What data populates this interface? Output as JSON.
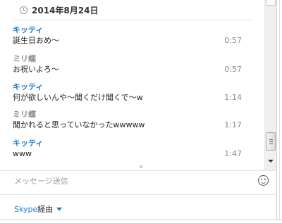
{
  "date_header": {
    "date": "2014年8月24日",
    "icon": "clock-icon"
  },
  "messages": [
    {
      "sender": "キッティ",
      "text": "誕生日おめ～",
      "time": "0:57"
    },
    {
      "sender": "ミリ蝶",
      "text": "お祝いよろ～",
      "time": "0:57"
    },
    {
      "sender": "キッティ",
      "text": "何が欲しいんや～聞くだけ聞くで～w",
      "time": "1:14"
    },
    {
      "sender": "ミリ蝶",
      "text": "聞かれると思っていなかったwwwww",
      "time": "1:17"
    },
    {
      "sender": "キッティ",
      "text": "www",
      "time": "1:47"
    }
  ],
  "compose": {
    "placeholder": "メッセージ送信",
    "emoji_icon": "smiley-icon"
  },
  "footer": {
    "via_service": "Skype",
    "via_suffix": "経由"
  },
  "colors": {
    "sender_kitty": "#1d7cc9",
    "sender_miri": "#8a8a8a",
    "link": "#1d7cc9"
  }
}
